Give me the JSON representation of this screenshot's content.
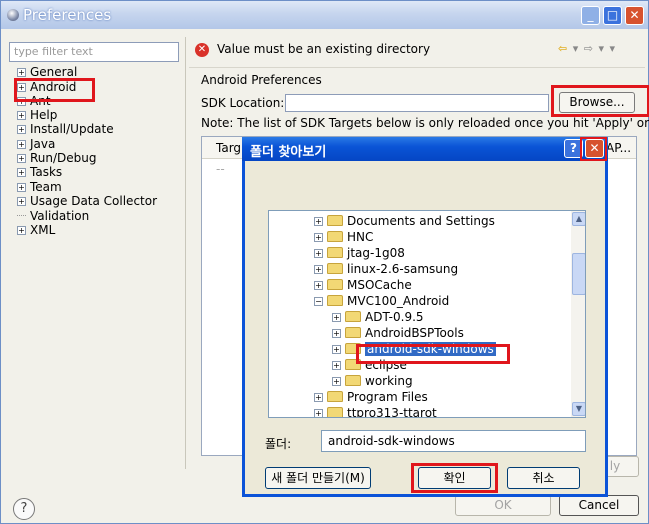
{
  "window": {
    "title": "Preferences"
  },
  "left": {
    "filter_placeholder": "type filter text",
    "tree": [
      "General",
      "Android",
      "Ant",
      "Help",
      "Install/Update",
      "Java",
      "Run/Debug",
      "Tasks",
      "Team",
      "Usage Data Collector",
      "Validation",
      "XML"
    ]
  },
  "main": {
    "error_message": "Value must be an existing directory",
    "page_title": "Android Preferences",
    "sdk_location_label": "SDK Location:",
    "sdk_location_value": "",
    "browse_label": "Browse...",
    "note": "Note: The list of SDK Targets below is only reloaded once you hit 'Apply' or 'OK'.",
    "targets_header_first": "Targ",
    "targets_header_last": "AP...",
    "targets_empty": "--",
    "apply_label": "ly",
    "ok_label": "OK",
    "cancel_label": "Cancel",
    "help_label": "?"
  },
  "dialog": {
    "title": "폴더 찾아보기",
    "folders": [
      {
        "label": "Documents and Settings",
        "level": 0,
        "expander": "+"
      },
      {
        "label": "HNC",
        "level": 0,
        "expander": "+"
      },
      {
        "label": "jtag-1g08",
        "level": 0,
        "expander": "+"
      },
      {
        "label": "linux-2.6-samsung",
        "level": 0,
        "expander": "+"
      },
      {
        "label": "MSOCache",
        "level": 0,
        "expander": "+"
      },
      {
        "label": "MVC100_Android",
        "level": 0,
        "expander": "-"
      },
      {
        "label": "ADT-0.9.5",
        "level": 1,
        "expander": "+"
      },
      {
        "label": "AndroidBSPTools",
        "level": 1,
        "expander": "+"
      },
      {
        "label": "android-sdk-windows",
        "level": 1,
        "expander": "+",
        "selected": true
      },
      {
        "label": "eclipse",
        "level": 1,
        "expander": "+"
      },
      {
        "label": "working",
        "level": 1,
        "expander": "+"
      },
      {
        "label": "Program Files",
        "level": 0,
        "expander": "+"
      },
      {
        "label": "ttpro313-ttarot",
        "level": 0,
        "expander": "+"
      }
    ],
    "folder_label": "폴더:",
    "folder_value": "android-sdk-windows",
    "new_folder_label": "새 폴더 만들기(M)",
    "confirm_label": "확인",
    "cancel_label": "취소"
  },
  "colors": {
    "highlight_box": "#e0161c",
    "selection": "#316ac5",
    "titlebar": "#0a54d6"
  }
}
